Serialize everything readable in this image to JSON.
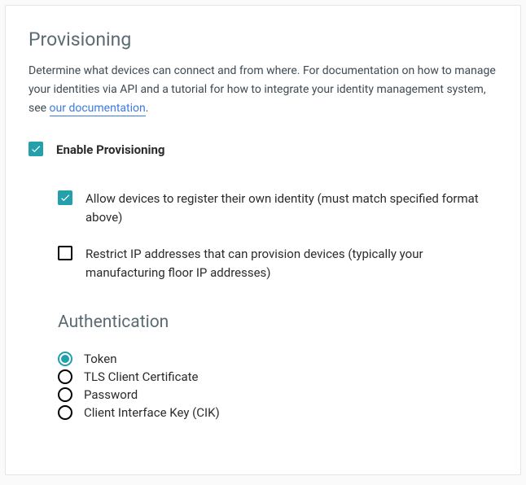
{
  "provisioning": {
    "title": "Provisioning",
    "desc_prefix": "Determine what devices can connect and from where. For documentation on how to manage your identities via API and a tutorial for how to integrate your identity management system, see ",
    "desc_link": "our documentation",
    "desc_suffix": ".",
    "enable_label": "Enable Provisioning",
    "enable_checked": true,
    "options": [
      {
        "label": "Allow devices to register their own identity (must match specified format above)",
        "checked": true
      },
      {
        "label": "Restrict IP addresses that can provision devices (typically your manufacturing floor IP addresses)",
        "checked": false
      }
    ]
  },
  "authentication": {
    "title": "Authentication",
    "options": [
      {
        "label": "Token",
        "selected": true
      },
      {
        "label": "TLS Client Certificate",
        "selected": false
      },
      {
        "label": "Password",
        "selected": false
      },
      {
        "label": "Client Interface Key (CIK)",
        "selected": false
      }
    ]
  }
}
